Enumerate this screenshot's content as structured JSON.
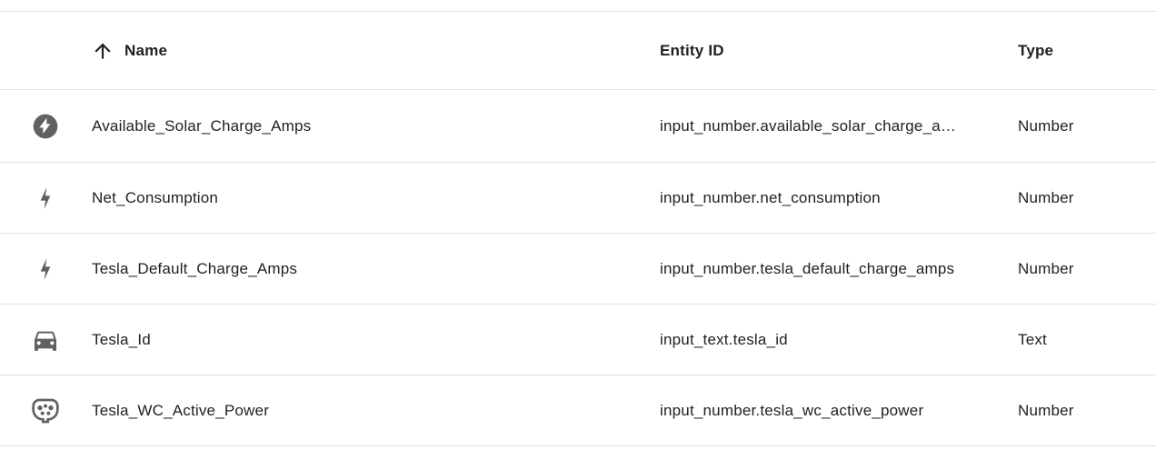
{
  "header": {
    "name": "Name",
    "entity_id": "Entity ID",
    "type": "Type",
    "sort_icon": "arrow-up-icon"
  },
  "rows": [
    {
      "icon": "flash-circle-icon",
      "name": "Available_Solar_Charge_Amps",
      "entity_id": "input_number.available_solar_charge_a…",
      "type": "Number"
    },
    {
      "icon": "flash-icon",
      "name": "Net_Consumption",
      "entity_id": "input_number.net_consumption",
      "type": "Number"
    },
    {
      "icon": "flash-icon",
      "name": "Tesla_Default_Charge_Amps",
      "entity_id": "input_number.tesla_default_charge_amps",
      "type": "Number"
    },
    {
      "icon": "car-icon",
      "name": "Tesla_Id",
      "entity_id": "input_text.tesla_id",
      "type": "Text"
    },
    {
      "icon": "ev-plug-icon",
      "name": "Tesla_WC_Active_Power",
      "entity_id": "input_number.tesla_wc_active_power",
      "type": "Number"
    }
  ],
  "colors": {
    "icon": "#616161",
    "divider": "#e0e0e0",
    "text": "#212121"
  }
}
